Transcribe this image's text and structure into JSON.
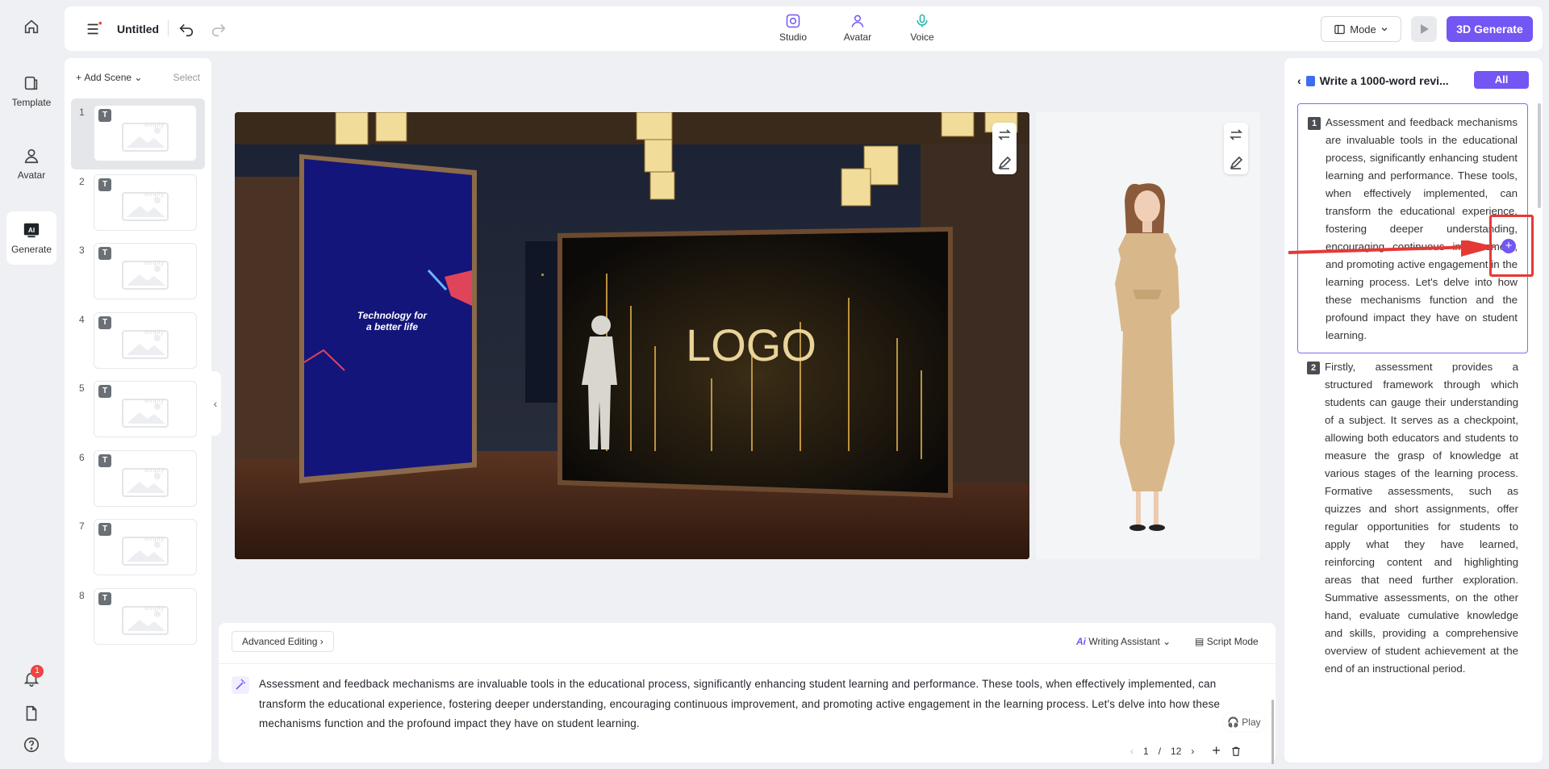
{
  "rail": {
    "items": [
      {
        "label": "Template"
      },
      {
        "label": "Avatar"
      },
      {
        "label": "Generate"
      }
    ],
    "notification_count": "1"
  },
  "topbar": {
    "title": "Untitled",
    "tabs": [
      {
        "label": "Studio"
      },
      {
        "label": "Avatar"
      },
      {
        "label": "Voice"
      }
    ],
    "mode_label": "Mode",
    "generate_label": "3D Generate"
  },
  "scenes": {
    "add_label": "Add Scene",
    "select_label": "Select",
    "items": [
      {
        "num": "1",
        "tag": "T"
      },
      {
        "num": "2",
        "tag": "T"
      },
      {
        "num": "3",
        "tag": "T"
      },
      {
        "num": "4",
        "tag": "T"
      },
      {
        "num": "5",
        "tag": "T"
      },
      {
        "num": "6",
        "tag": "T"
      },
      {
        "num": "7",
        "tag": "T"
      },
      {
        "num": "8",
        "tag": "T"
      }
    ],
    "empty_label": "empty"
  },
  "stage": {
    "banner_text_1": "Technology for",
    "banner_text_2": "a better life",
    "logo_text": "LOGO"
  },
  "editor": {
    "advanced_label": "Advanced Editing",
    "writing_assistant_label": "Writing Assistant",
    "script_mode_label": "Script Mode",
    "text": "Assessment and feedback mechanisms are invaluable tools in the educational process, significantly enhancing student learning and performance. These tools, when effectively implemented, can transform the educational experience, fostering deeper understanding, encouraging continuous improvement, and promoting active engagement in the learning process. Let's delve into how these mechanisms function and the profound impact they have on student learning.",
    "play_label": "Play",
    "page_current": "1",
    "page_sep": "/",
    "page_total": "12"
  },
  "rpanel": {
    "title": "Write a 1000-word revi...",
    "all_label": "All",
    "paragraphs": [
      {
        "num": "1",
        "text": "Assessment and feedback mechanisms are invaluable tools in the educational process, significantly enhancing student learning and performance. These tools, when effectively implemented, can transform the educational experience, fostering deeper understanding, encouraging continuous improvement, and promoting active engagement in the learning process. Let's delve into how these mechanisms function and the profound impact they have on student learning."
      },
      {
        "num": "2",
        "text": "Firstly, assessment provides a structured framework through which students can gauge their understanding of a subject. It serves as a checkpoint, allowing both educators and students to measure the grasp of knowledge at various stages of the learning process. Formative assessments, such as quizzes and short assignments, offer regular opportunities for students to apply what they have learned, reinforcing content and highlighting areas that need further exploration. Summative assessments, on the other hand, evaluate cumulative knowledge and skills, providing a comprehensive overview of student achievement at the end of an instructional period."
      }
    ]
  },
  "colors": {
    "accent": "#7356f3",
    "annotation": "#e53935"
  }
}
